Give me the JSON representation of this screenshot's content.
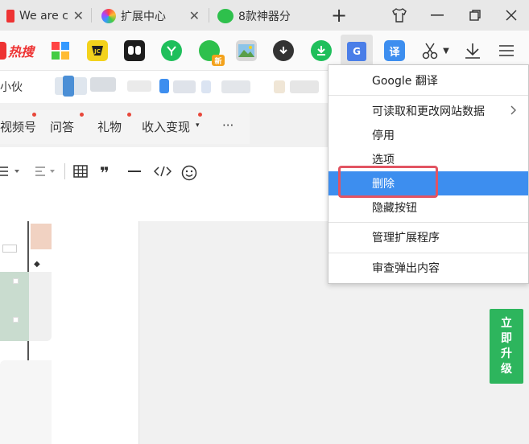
{
  "tabs": [
    {
      "label": "We are c",
      "icon": "web-icon"
    },
    {
      "label": "扩展中心",
      "icon": "rainbow-circle-icon"
    },
    {
      "label": "8款神器分",
      "icon": "wechat-icon"
    }
  ],
  "new_tab": "+",
  "toolbar": {
    "hot_label": "热搜",
    "translate_label": "译"
  },
  "bookmarks": {
    "partial_text": "小伙"
  },
  "nav": {
    "items": [
      "视频号",
      "问答",
      "礼物",
      "收入变现",
      "···"
    ],
    "dropdown_mark": "▾"
  },
  "menu": {
    "title": "Google 翻译",
    "items": [
      "可读取和更改网站数据",
      "停用",
      "选项",
      "删除",
      "隐藏按钮",
      "管理扩展程序",
      "审查弹出内容"
    ],
    "highlighted": "删除"
  },
  "upgrade_chars": [
    "立",
    "即",
    "升",
    "级"
  ],
  "colors": {
    "highlight": "#3d8eef",
    "annotation": "#e25462",
    "upgrade": "#2db55d"
  }
}
